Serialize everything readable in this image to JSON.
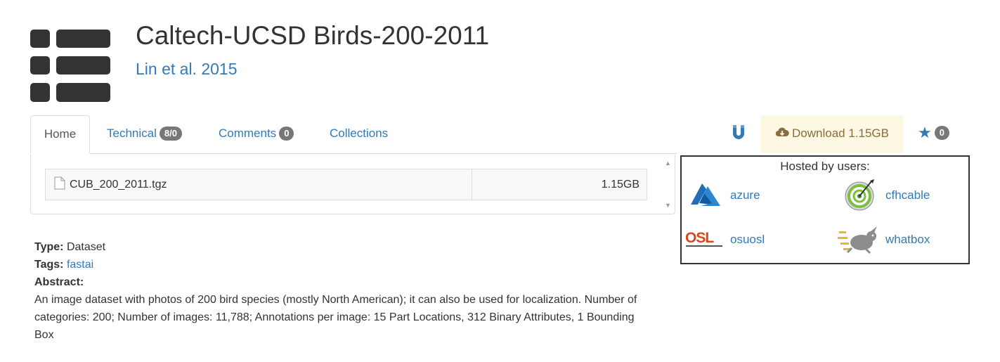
{
  "header": {
    "title": "Caltech-UCSD Birds-200-2011",
    "author": "Lin et al. 2015",
    "logo_icon": "dataset-list-icon"
  },
  "tabs": [
    {
      "label": "Home",
      "active": true
    },
    {
      "label": "Technical",
      "badge": "8/0"
    },
    {
      "label": "Comments",
      "badge": "0"
    },
    {
      "label": "Collections"
    }
  ],
  "actions": {
    "magnet_icon": "magnet-icon",
    "download_label": "Download 1.15GB",
    "download_icon": "cloud-download-icon",
    "star_icon": "star-icon",
    "star_count": "0"
  },
  "files": [
    {
      "name": "CUB_200_2011.tgz",
      "size": "1.15GB",
      "icon": "file-icon"
    }
  ],
  "hosted": {
    "title": "Hosted by users:",
    "hosts": [
      {
        "name": "azure",
        "icon": "azure-icon"
      },
      {
        "name": "cfhcable",
        "icon": "cfhcable-icon"
      },
      {
        "name": "osuosl",
        "icon": "osl-icon"
      },
      {
        "name": "whatbox",
        "icon": "whatbox-icon"
      }
    ]
  },
  "info": {
    "type_label": "Type:",
    "type_value": "Dataset",
    "tags_label": "Tags:",
    "tags_value": "fastai",
    "abstract_label": "Abstract:",
    "abstract_text": "An image dataset with photos of 200 bird species (mostly North American); it can also be used for localization. Number of categories: 200; Number of images: 11,788; Annotations per image: 15 Part Locations, 312 Binary Attributes, 1 Bounding Box"
  },
  "colors": {
    "link": "#337ab7",
    "badge": "#777777",
    "download_bg": "#fcf8e3",
    "download_text": "#8a6d3b"
  }
}
